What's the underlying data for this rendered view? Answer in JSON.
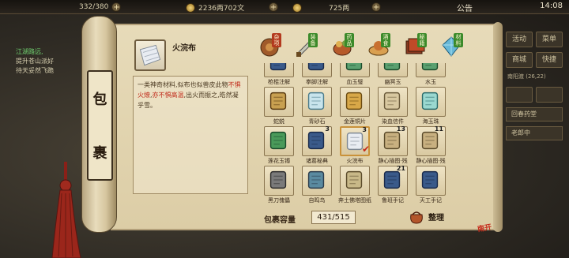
{
  "topbar": {
    "stamina": "332/380",
    "silver": "2236两702文",
    "gold": "725两",
    "notice": "公告",
    "time": "14:08"
  },
  "quest": {
    "title": "江湖路远,",
    "lines": [
      "提升苍山派好",
      "待天妥然飞跪"
    ]
  },
  "right_menu": {
    "row1": [
      "活动",
      "菜单"
    ],
    "row2": [
      "商城",
      "快捷"
    ],
    "info": "南阳渡 (26,22)",
    "row3": [
      "",
      ""
    ],
    "wide1": "回春药堂",
    "wide2": "老郎中"
  },
  "panel": {
    "title_chars": [
      "包",
      "裹"
    ]
  },
  "detail": {
    "name": "火浣布",
    "desc_pre": "一类神奇材料,似布也似兽皮此物",
    "desc_hl1": "不惧火燎",
    "desc_mid": ",",
    "desc_hl2": "亦不惧高温",
    "desc_post": ",出火而振之,皓然凝乎雪。"
  },
  "categories": [
    {
      "label": "杂项",
      "icon": "sundries-icon",
      "active": true
    },
    {
      "label": "装备",
      "icon": "equipment-icon",
      "active": false
    },
    {
      "label": "药品",
      "icon": "medicine-icon",
      "active": false
    },
    {
      "label": "酒食",
      "icon": "food-icon",
      "active": false
    },
    {
      "label": "秘籍",
      "icon": "manual-icon",
      "active": false
    },
    {
      "label": "材料",
      "icon": "material-icon",
      "active": false
    }
  ],
  "items": [
    {
      "name": "枪棍注解",
      "icon": "book-icon",
      "count": ""
    },
    {
      "name": "拳脚注解",
      "icon": "book-icon",
      "count": ""
    },
    {
      "name": "血玉璧",
      "icon": "jade-icon",
      "count": ""
    },
    {
      "name": "幽冥玉",
      "icon": "jade-icon",
      "count": ""
    },
    {
      "name": "水玉",
      "icon": "jade-icon",
      "count": ""
    },
    {
      "name": "蛇蜕",
      "icon": "snake-skin-icon",
      "count": ""
    },
    {
      "name": "青砂石",
      "icon": "crystal-icon",
      "count": ""
    },
    {
      "name": "金莲铜片",
      "icon": "lotus-icon",
      "count": ""
    },
    {
      "name": "染血信件",
      "icon": "letter-icon",
      "count": ""
    },
    {
      "name": "海玉珠",
      "icon": "pearl-icon",
      "count": ""
    },
    {
      "name": "莲花玉镯",
      "icon": "bracelet-icon",
      "count": ""
    },
    {
      "name": "诸葛秘典",
      "icon": "book-icon",
      "count": "3"
    },
    {
      "name": "火浣布",
      "icon": "cloth-icon",
      "count": "3",
      "selected": true
    },
    {
      "name": "静心插图·残",
      "icon": "scroll-icon",
      "count": "13"
    },
    {
      "name": "静心插图·残",
      "icon": "scroll-icon",
      "count": "11"
    },
    {
      "name": "黑刀傀儡",
      "icon": "puppet-icon",
      "count": ""
    },
    {
      "name": "自鸣鸟",
      "icon": "bird-icon",
      "count": ""
    },
    {
      "name": "奔土佛塔图纸",
      "icon": "blueprint-icon",
      "count": ""
    },
    {
      "name": "鲁班手记",
      "icon": "book-icon",
      "count": "21"
    },
    {
      "name": "天工手记",
      "icon": "book-icon",
      "count": ""
    }
  ],
  "capacity": {
    "label": "包裹容量",
    "value": "431/515"
  },
  "sort_button": "整理",
  "seal_text": "南开"
}
